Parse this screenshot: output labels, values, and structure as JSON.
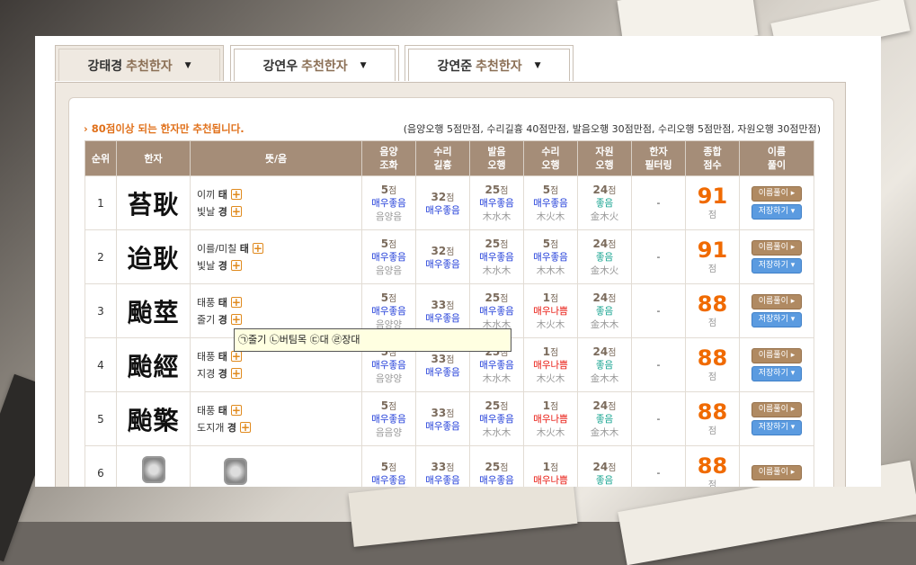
{
  "tabs": [
    {
      "name": "강태경",
      "sub": "추천한자",
      "active": true
    },
    {
      "name": "강연우",
      "sub": "추천한자",
      "active": false
    },
    {
      "name": "강연준",
      "sub": "추천한자",
      "active": false
    }
  ],
  "notice": {
    "left": "› 80점이상 되는 한자만 추천됩니다.",
    "right": "(음양오행 5점만점, 수리길흉 40점만점, 발음오행 30점만점, 수리오행 5점만점, 자원오행 30점만점)"
  },
  "headers": [
    "순위",
    "한자",
    "뜻/음",
    "음양\n조화",
    "수리\n길흉",
    "발음\n오행",
    "수리\n오행",
    "자원\n오행",
    "한자\n필터링",
    "종합\n점수",
    "이름\n풀이"
  ],
  "rows": [
    {
      "rank": "1",
      "hanja": "苔耿",
      "m1": "이끼 태",
      "m2": "빛날 경",
      "yy": [
        "5",
        "매우좋음",
        "음양음"
      ],
      "sr": [
        "32",
        "매우좋음"
      ],
      "bu": [
        "25",
        "매우좋음",
        "木水木"
      ],
      "so": [
        "5",
        "매우좋음",
        "木火木"
      ],
      "jw": [
        "24",
        "좋음",
        "金木火"
      ],
      "filter": "-",
      "total": "91"
    },
    {
      "rank": "2",
      "hanja": "迨耿",
      "m1": "이를/미칠 태",
      "m2": "빛날 경",
      "yy": [
        "5",
        "매우좋음",
        "음양음"
      ],
      "sr": [
        "32",
        "매우좋음"
      ],
      "bu": [
        "25",
        "매우좋음",
        "木水木"
      ],
      "so": [
        "5",
        "매우좋음",
        "木木木"
      ],
      "jw": [
        "24",
        "좋음",
        "金木火"
      ],
      "filter": "-",
      "total": "91"
    },
    {
      "rank": "3",
      "hanja": "颱莖",
      "m1": "태풍 태",
      "m2": "줄기 경",
      "yy": [
        "5",
        "매우좋음",
        "음양양"
      ],
      "sr": [
        "33",
        "매우좋음"
      ],
      "bu": [
        "25",
        "매우좋음",
        "木水木"
      ],
      "so": [
        "1",
        "매우나쁨",
        "木火木"
      ],
      "jw": [
        "24",
        "좋음",
        "金木木"
      ],
      "filter": "-",
      "total": "88"
    },
    {
      "rank": "4",
      "hanja": "颱經",
      "m1": "태풍 태",
      "m2": "지경 경",
      "yy": [
        "5",
        "매우좋음",
        "음양양"
      ],
      "sr": [
        "33",
        "매우좋음"
      ],
      "bu": [
        "25",
        "매우좋음",
        "木水木"
      ],
      "so": [
        "1",
        "매우나쁨",
        "木火木"
      ],
      "jw": [
        "24",
        "좋음",
        "金木木"
      ],
      "filter": "-",
      "total": "88"
    },
    {
      "rank": "5",
      "hanja": "颱檠",
      "m1": "태풍 태",
      "m2": "도지개 경",
      "yy": [
        "5",
        "매우좋음",
        "음음양"
      ],
      "sr": [
        "33",
        "매우좋음"
      ],
      "bu": [
        "25",
        "매우좋음",
        "木水木"
      ],
      "so": [
        "1",
        "매우나쁨",
        "木火木"
      ],
      "jw": [
        "24",
        "좋음",
        "金木木"
      ],
      "filter": "-",
      "total": "88"
    },
    {
      "rank": "6",
      "hanja": "",
      "m1": "",
      "m2": "",
      "yy": [
        "5",
        "매우좋음",
        ""
      ],
      "sr": [
        "33",
        "매우좋음"
      ],
      "bu": [
        "25",
        "매우좋음",
        ""
      ],
      "so": [
        "1",
        "매우나쁨",
        ""
      ],
      "jw": [
        "24",
        "좋음",
        ""
      ],
      "filter": "-",
      "total": "88"
    }
  ],
  "labels": {
    "point": "점",
    "total_unit": "점",
    "explain": "이름풀이 ▸",
    "save": "저장하기 ▾"
  },
  "tooltip": "㉠줄기 ㉡버팀목 ㉢대 ㉣장대"
}
